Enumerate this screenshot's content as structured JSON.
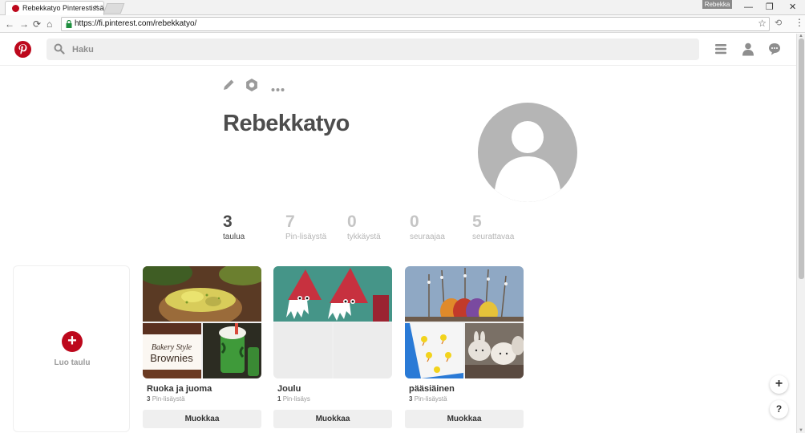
{
  "browser": {
    "tab_title": "Rebekkatyo Pinterestissä",
    "tab_close": "×",
    "user_badge": "Rebekka",
    "url": "https://fi.pinterest.com/rebekkatyo/",
    "window": {
      "minimize": "—",
      "restore": "❐",
      "close": "✕"
    },
    "nav": {
      "back": "←",
      "forward": "→",
      "reload": "⟳",
      "home": "⌂"
    },
    "star": "☆",
    "extension": "⟲",
    "menu": "⋮"
  },
  "header": {
    "search_placeholder": "Haku",
    "icons": [
      "pinterest-logo",
      "search-icon",
      "menu-icon",
      "profile-icon",
      "messages-icon"
    ]
  },
  "profile": {
    "name": "Rebekkatyo",
    "action_icons": [
      "edit-pencil-icon",
      "settings-gear-icon",
      "more-dots-icon"
    ],
    "stats": [
      {
        "value": "3",
        "label": "taulua"
      },
      {
        "value": "7",
        "label": "Pin-lisäystä"
      },
      {
        "value": "0",
        "label": "tykkäystä"
      },
      {
        "value": "0",
        "label": "seuraajaa"
      },
      {
        "value": "5",
        "label": "seurattavaa"
      }
    ]
  },
  "create_board": {
    "plus": "+",
    "label": "Luo taulu"
  },
  "boards": [
    {
      "title": "Ruoka ja juoma",
      "count": "3",
      "count_label": "Pin-lisäystä",
      "edit_label": "Muokkaa",
      "brownies_line1": "Bakery Style",
      "brownies_line2": "Brownies"
    },
    {
      "title": "Joulu",
      "count": "1",
      "count_label": "Pin-lisäys",
      "edit_label": "Muokkaa"
    },
    {
      "title": "pääsiäinen",
      "count": "3",
      "count_label": "Pin-lisäystä",
      "edit_label": "Muokkaa"
    }
  ],
  "floating": {
    "add": "+",
    "help": "?"
  },
  "colors": {
    "brand_red": "#bd081c",
    "search_bg": "#efefef",
    "avatar_gray": "#b5b5b5"
  }
}
